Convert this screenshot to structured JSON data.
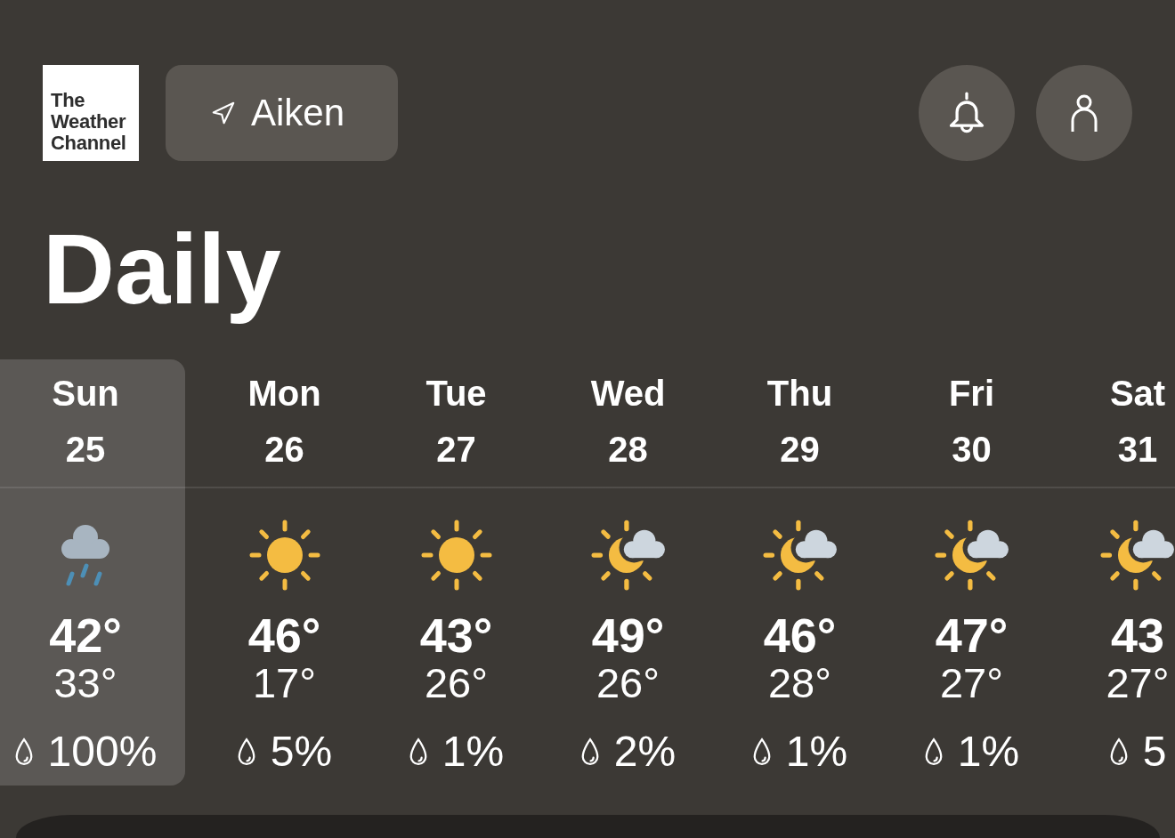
{
  "header": {
    "logo": "The Weather Channel",
    "location": "Aiken"
  },
  "title": "Daily",
  "days": [
    {
      "day": "Sun",
      "date": "25",
      "kind": "rain",
      "high": "42°",
      "low": "33°",
      "precip": "100%",
      "selected": true
    },
    {
      "day": "Mon",
      "date": "26",
      "kind": "sun",
      "high": "46°",
      "low": "17°",
      "precip": "5%",
      "selected": false
    },
    {
      "day": "Tue",
      "date": "27",
      "kind": "sun",
      "high": "43°",
      "low": "26°",
      "precip": "1%",
      "selected": false
    },
    {
      "day": "Wed",
      "date": "28",
      "kind": "partly-cloudy",
      "high": "49°",
      "low": "26°",
      "precip": "2%",
      "selected": false
    },
    {
      "day": "Thu",
      "date": "29",
      "kind": "partly-cloudy",
      "high": "46°",
      "low": "28°",
      "precip": "1%",
      "selected": false
    },
    {
      "day": "Fri",
      "date": "30",
      "kind": "partly-cloudy",
      "high": "47°",
      "low": "27°",
      "precip": "1%",
      "selected": false
    },
    {
      "day": "Sat",
      "date": "31",
      "kind": "partly-cloudy",
      "high": "43",
      "low": "27°",
      "precip": "5",
      "selected": false
    }
  ]
}
